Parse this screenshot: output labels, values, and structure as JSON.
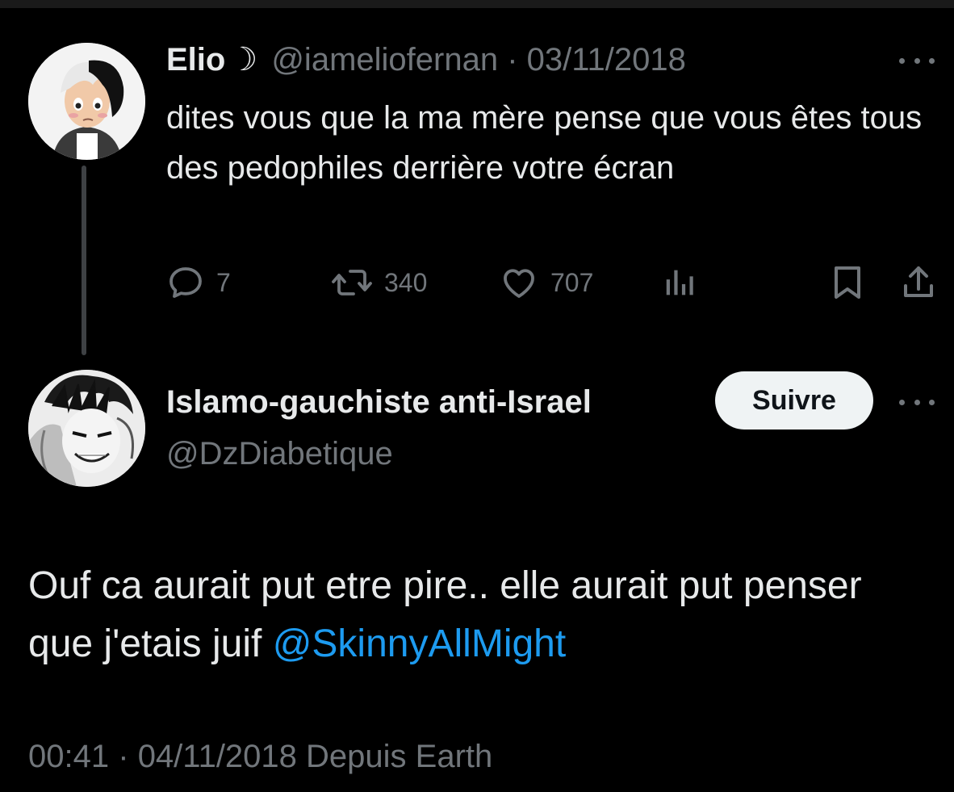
{
  "parent_tweet": {
    "name": "Elio",
    "name_emoji": "☽",
    "handle": "@iameliofernan",
    "separator": "·",
    "date": "03/11/2018",
    "text": "dites vous que la ma mère pense que vous êtes tous des pedophiles derrière votre écran",
    "actions": {
      "replies": "7",
      "retweets": "340",
      "likes": "707"
    }
  },
  "reply_tweet": {
    "name": "Islamo-gauchiste anti-Israel",
    "handle": "@DzDiabetique",
    "follow_label": "Suivre",
    "text": "Ouf ca aurait put etre pire.. elle aurait put penser que j'etais juif",
    "mention": "@SkinnyAllMight",
    "time": "00:41",
    "separator": "·",
    "date": "04/11/2018",
    "source": "Depuis Earth"
  },
  "icons": {
    "reply": "reply-icon",
    "retweet": "retweet-icon",
    "like": "heart-icon",
    "views": "views-icon",
    "bookmark": "bookmark-icon",
    "share": "share-icon",
    "more": "more-options-icon"
  },
  "colors": {
    "background": "#000000",
    "text": "#e7e9ea",
    "muted": "#71767b",
    "link": "#1d9bf0",
    "button_bg": "#eff3f4"
  }
}
